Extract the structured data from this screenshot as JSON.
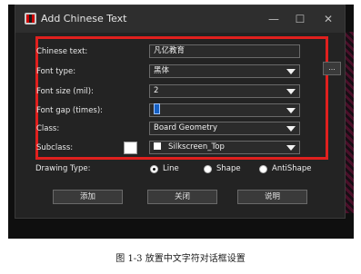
{
  "window": {
    "title": "Add Chinese Text",
    "controls": {
      "minimize": "—",
      "maximize": "☐",
      "close": "✕"
    }
  },
  "form": {
    "chinese_text": {
      "label": "Chinese text:",
      "value": "凡亿教育"
    },
    "font_type": {
      "label": "Font type:",
      "value": "黑体"
    },
    "font_size": {
      "label": "Font size (mil):",
      "value": "2"
    },
    "font_gap": {
      "label": "Font gap (times):",
      "value": "1"
    },
    "class": {
      "label": "Class:",
      "value": "Board Geometry"
    },
    "subclass": {
      "label": "Subclass:",
      "value": "Silkscreen_Top"
    },
    "more_button": "..."
  },
  "drawing_type": {
    "label": "Drawing Type:",
    "options": [
      "Line",
      "Shape",
      "AntiShape"
    ],
    "selected": "Line"
  },
  "buttons": {
    "add": "添加",
    "close": "关闭",
    "help": "说明"
  },
  "caption": "图  1-3  放置中文字符对话框设置",
  "colors": {
    "highlight": "#e0201e",
    "dialog_bg": "#232323"
  }
}
